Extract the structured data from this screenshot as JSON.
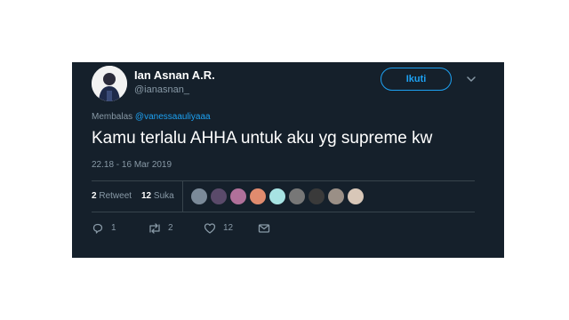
{
  "author": {
    "display_name": "Ian Asnan A.R.",
    "handle": "@ianasnan_"
  },
  "follow_label": "Ikuti",
  "reply_to": {
    "prefix": "Membalas",
    "mention": "@vanessaauliyaaa"
  },
  "tweet": {
    "text": "Kamu terlalu AHHA untuk aku yg supreme kw",
    "timestamp": "22.18 - 16 Mar 2019"
  },
  "stats": {
    "retweet_count": "2",
    "retweet_label": "Retweet",
    "like_count": "12",
    "like_label": "Suka"
  },
  "liker_avatars": [
    {
      "color": "#7b8a99"
    },
    {
      "color": "#5a4a6a"
    },
    {
      "color": "#b0709a"
    },
    {
      "color": "#e08b6e"
    },
    {
      "color": "#a7e3e3"
    },
    {
      "color": "#777777"
    },
    {
      "color": "#3a3a3a"
    },
    {
      "color": "#9a8f86"
    },
    {
      "color": "#d8c7b8"
    }
  ],
  "actions": {
    "reply_count": "1",
    "retweet_count": "2",
    "like_count": "12"
  },
  "icons": {
    "reply": "reply-icon",
    "retweet": "retweet-icon",
    "like": "heart-icon",
    "message": "envelope-icon",
    "more": "chevron-down-icon"
  },
  "colors": {
    "card_background": "#15202b",
    "accent": "#1da1f2",
    "muted_text": "#8899a6",
    "divider": "#38444d"
  }
}
